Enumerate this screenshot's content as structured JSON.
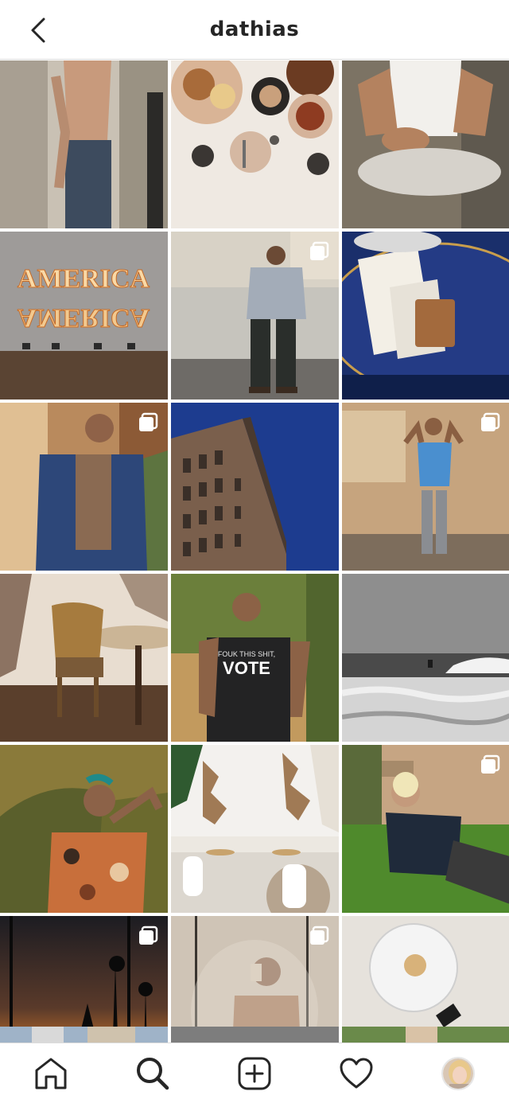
{
  "header": {
    "username": "dathias",
    "back_icon": "chevron-left-icon"
  },
  "grid": {
    "rows": [
      [
        {
          "name": "post-shirtless-doorway",
          "multi": false
        },
        {
          "name": "post-food-table",
          "multi": false
        },
        {
          "name": "post-tank-top",
          "multi": false
        }
      ],
      [
        {
          "name": "post-america-neon",
          "multi": false,
          "neon_text": "AMERICA"
        },
        {
          "name": "post-grey-sweater",
          "multi": true
        },
        {
          "name": "post-blue-table-wallet",
          "multi": false
        }
      ],
      [
        {
          "name": "post-puffer-jacket",
          "multi": true
        },
        {
          "name": "post-building-sky",
          "multi": false
        },
        {
          "name": "post-blue-tee-room",
          "multi": true
        }
      ],
      [
        {
          "name": "post-rattan-chair",
          "multi": false
        },
        {
          "name": "post-vote-shirt",
          "multi": false,
          "shirt_text_top": "FOUK THIS SHIT,",
          "shirt_text": "VOTE"
        },
        {
          "name": "post-surfer-ocean",
          "multi": false
        }
      ],
      [
        {
          "name": "post-floral-shirt",
          "multi": false
        },
        {
          "name": "post-white-interior",
          "multi": false
        },
        {
          "name": "post-lying-grass",
          "multi": true
        }
      ],
      [
        {
          "name": "post-sunset-palms",
          "multi": true
        },
        {
          "name": "post-mirror-selfie",
          "multi": true
        },
        {
          "name": "post-glass-table-feet",
          "multi": false
        }
      ]
    ]
  },
  "tabbar": {
    "items": [
      {
        "name": "home-tab",
        "icon": "home-icon"
      },
      {
        "name": "search-tab",
        "icon": "search-icon"
      },
      {
        "name": "new-post-tab",
        "icon": "plus-square-icon"
      },
      {
        "name": "activity-tab",
        "icon": "heart-icon"
      },
      {
        "name": "profile-tab",
        "icon": "avatar"
      }
    ]
  },
  "colors": {
    "header_border": "#dbdbdb",
    "text": "#262626"
  }
}
